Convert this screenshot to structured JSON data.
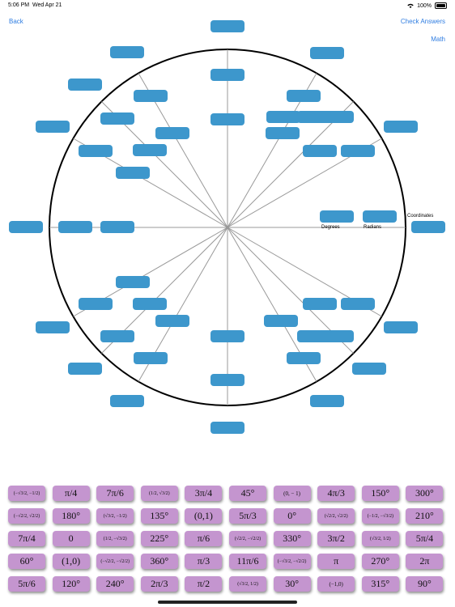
{
  "status_bar": {
    "time": "5:06 PM",
    "date": "Wed Apr 21",
    "battery": "100%"
  },
  "nav": {
    "back": "Back",
    "check": "Check Answers",
    "math": "Math"
  },
  "legend": {
    "degrees": "Degrees",
    "radians": "Radians",
    "coordinates": "Coordinates"
  },
  "tiles": [
    [
      "(−√3/2, −1/2)",
      "π/4",
      "7π/6",
      "(1/2, √3/2)",
      "3π/4",
      "45°",
      "(0, − 1)",
      "4π/3",
      "150°",
      "300°"
    ],
    [
      "(−√2/2, √2/2)",
      "180°",
      "(√3/2, −1/2)",
      "135°",
      "(0,1)",
      "5π/3",
      "0°",
      "(√2/2, √2/2)",
      "(−1/2, −√3/2)",
      "210°"
    ],
    [
      "7π/4",
      "0",
      "(1/2, −√3/2)",
      "225°",
      "π/6",
      "(√2/2, −√2/2)",
      "330°",
      "3π/2",
      "(√3/2, 1/2)",
      "5π/4"
    ],
    [
      "60°",
      "(1,0)",
      "(−√2/2, −√2/2)",
      "360°",
      "π/3",
      "11π/6",
      "(−√3/2, −√2/2)",
      "π",
      "270°",
      "2π"
    ],
    [
      "5π/6",
      "120°",
      "240°",
      "2π/3",
      "π/2",
      "(√3/2, 1/2)",
      "30°",
      "(−1,0)",
      "315°",
      "90°"
    ]
  ]
}
